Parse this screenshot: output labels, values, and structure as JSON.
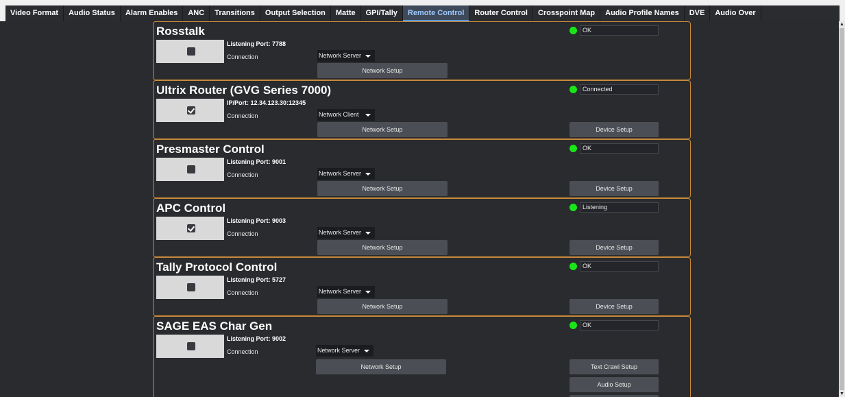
{
  "tabs": [
    "Video Format",
    "Audio Status",
    "Alarm Enables",
    "ANC",
    "Transitions",
    "Output Selection",
    "Matte",
    "GPI/Tally",
    "Remote Control",
    "Router Control",
    "Crosspoint Map",
    "Audio Profile Names",
    "DVE",
    "Audio Over"
  ],
  "active_tab": "Remote Control",
  "colors": {
    "accent_border": "#c98a3a",
    "led_green": "#19e619",
    "active_tab_text": "#9ec8ff"
  },
  "labels": {
    "connection": "Connection",
    "network_setup": "Network Setup",
    "device_setup": "Device Setup",
    "text_crawl_setup": "Text Crawl Setup",
    "audio_setup": "Audio Setup"
  },
  "panels": [
    {
      "title": "Rosstalk",
      "enabled": false,
      "port_text": "Listening Port: 7788",
      "connection": "Network Server",
      "status": "OK"
    },
    {
      "title": "Ultrix Router (GVG Series 7000)",
      "enabled": true,
      "port_text": "IP/Port: 12.34.123.30:12345",
      "connection": "Network Client",
      "status": "Connected"
    },
    {
      "title": "Presmaster Control",
      "enabled": false,
      "port_text": "Listening Port: 9001",
      "connection": "Network Server",
      "status": "OK"
    },
    {
      "title": "APC Control",
      "enabled": true,
      "port_text": "Listening Port: 9003",
      "connection": "Network Server",
      "status": "Listening"
    },
    {
      "title": "Tally Protocol Control",
      "enabled": false,
      "port_text": "Listening Port: 5727",
      "connection": "Network Server",
      "status": "OK"
    },
    {
      "title": "SAGE EAS Char Gen",
      "enabled": false,
      "port_text": "Listening Port: 9002",
      "connection": "Network Server",
      "status": "OK"
    }
  ]
}
